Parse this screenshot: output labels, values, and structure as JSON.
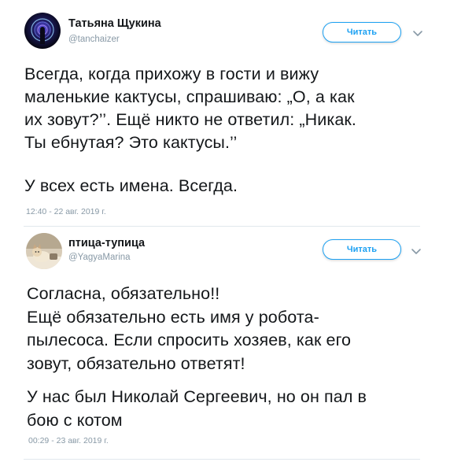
{
  "tweets": [
    {
      "author_name": "Татьяна Щукина",
      "author_handle": "@tanchaizer",
      "follow_label": "Читать",
      "paragraphs": [
        "Всегда, когда прихожу в гости и вижу\nмаленькие кактусы, спрашиваю: „О, а как\nих зовут?’’. Ещё никто не ответил: „Никак.\nТы ебнутая? Это кактусы.’’",
        "У всех есть имена. Всегда."
      ],
      "timestamp": "12:40 - 22 авг. 2019 г."
    },
    {
      "author_name": "птица-тупица",
      "author_handle": "@YagyaMarina",
      "follow_label": "Читать",
      "paragraphs": [
        "Согласна, обязательно!!\nЕщё обязательно есть имя у робота-\nпылесоса. Если спросить хозяев, как его\nзовут, обязательно ответят!",
        "У нас был Николай Сергеевич, но он пал в\nбою с котом"
      ],
      "timestamp": "00:29 - 23 авг. 2019 г."
    }
  ],
  "colors": {
    "accent": "#1da1f2",
    "text": "#14171a",
    "muted": "#8899a6"
  },
  "icons": {
    "chevron": "chevron-down-icon"
  }
}
